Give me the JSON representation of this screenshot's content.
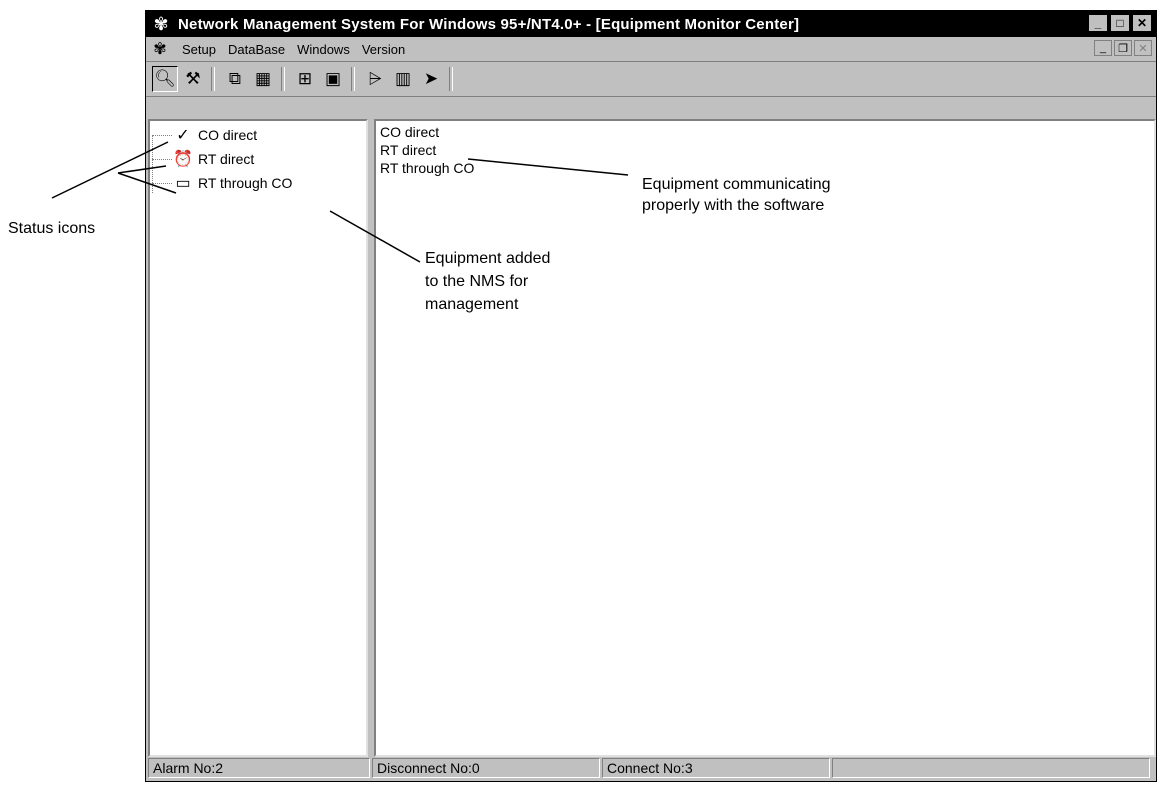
{
  "window": {
    "title": "Network Management System For Windows 95+/NT4.0+  - [Equipment Monitor Center]",
    "controls": [
      "minimize",
      "maximize",
      "close"
    ]
  },
  "menubar": {
    "items": [
      {
        "label": "Setup"
      },
      {
        "label": "DataBase"
      },
      {
        "label": "Windows"
      },
      {
        "label": "Version"
      }
    ]
  },
  "toolbar": {
    "tools": [
      "magnifier-icon",
      "tool-icon",
      "copy-icon",
      "grid-icon",
      "tree-icon",
      "monitor-icon",
      "chart-icon",
      "bars-icon",
      "arrow-icon"
    ]
  },
  "tree": {
    "items": [
      {
        "label": "CO direct",
        "icon": "checkmark-icon"
      },
      {
        "label": "RT direct",
        "icon": "alarm-clock-icon"
      },
      {
        "label": "RT through CO",
        "icon": "card-icon"
      }
    ]
  },
  "list": {
    "items": [
      {
        "label": "CO direct"
      },
      {
        "label": "RT direct"
      },
      {
        "label": "RT through CO"
      }
    ]
  },
  "statusbar": {
    "alarm": "Alarm No:2",
    "disconnect": "Disconnect No:0",
    "connect": "Connect No:3"
  },
  "annotations": {
    "status_icons": "Status icons",
    "equipment_added_1": "Equipment added",
    "equipment_added_2": "to the NMS for",
    "equipment_added_3": "management",
    "equipment_comm_1": "Equipment communicating",
    "equipment_comm_2": "properly with  the software"
  }
}
